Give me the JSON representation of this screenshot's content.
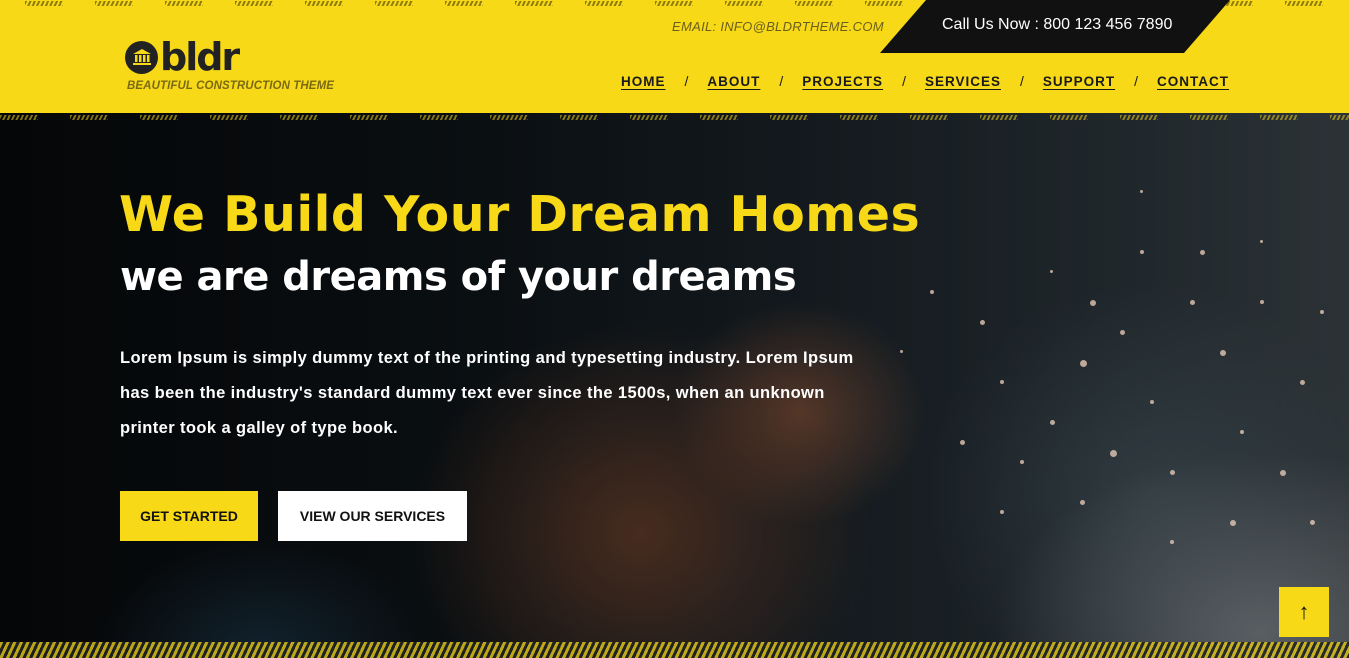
{
  "header": {
    "logo_text": "bldr",
    "tagline": "BEAUTIFUL CONSTRUCTION THEME",
    "email": "EMAIL: INFO@BLDRTHEME.COM",
    "call": "Call Us Now : 800 123 456 7890",
    "nav": [
      "HOME",
      "ABOUT",
      "PROJECTS",
      "SERVICES",
      "SUPPORT",
      "CONTACT"
    ],
    "nav_separator": "/"
  },
  "hero": {
    "title": "We Build Your Dream Homes",
    "subtitle": "we are dreams of your dreams",
    "description": "Lorem Ipsum is simply dummy text of the printing and typesetting industry. Lorem Ipsum has been the industry's standard dummy text ever since the 1500s, when an unknown printer took a galley of type book.",
    "primary_button": "GET STARTED",
    "secondary_button": "VIEW OUR SERVICES"
  },
  "scroll_top": {
    "icon": "arrow-up-icon",
    "glyph": "↑"
  },
  "colors": {
    "brand_yellow": "#f7d917",
    "dark": "#111111"
  }
}
